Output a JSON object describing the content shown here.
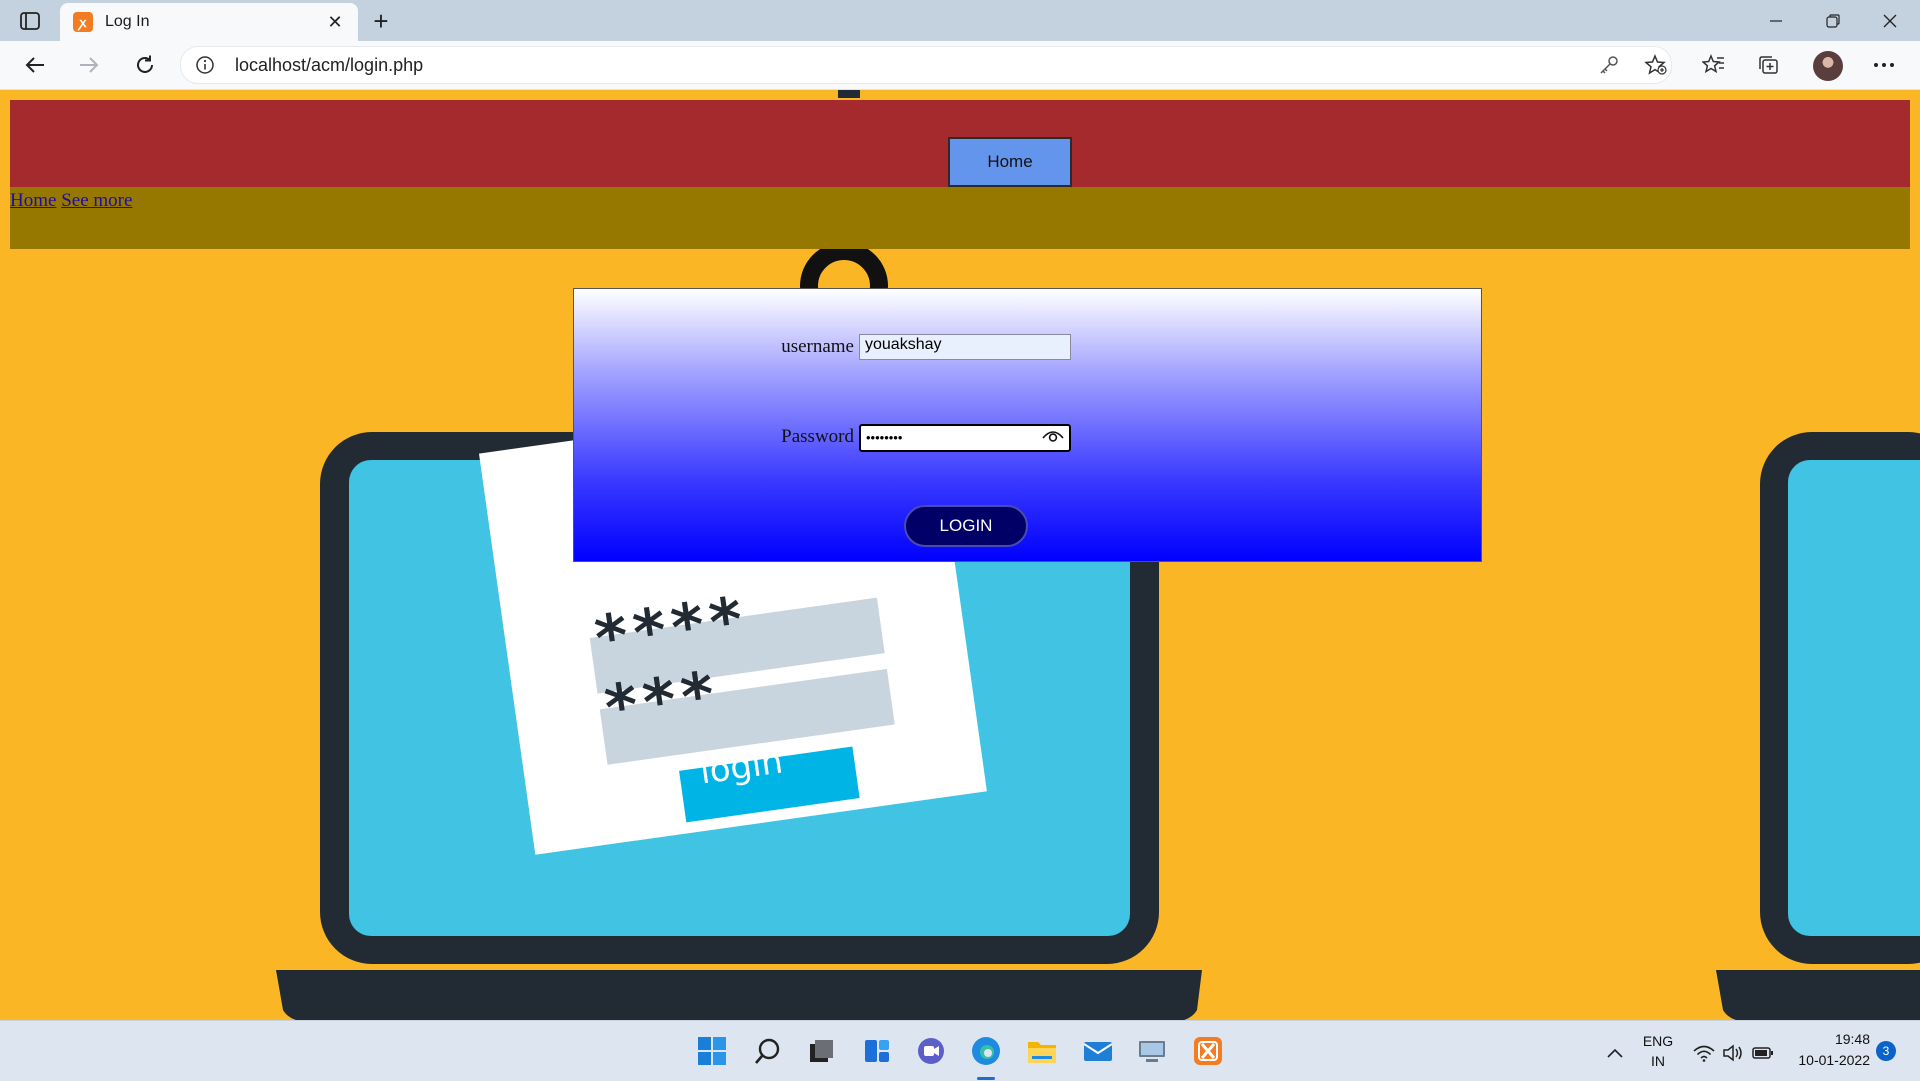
{
  "browser": {
    "tab_title": "Log In",
    "favicon_glyph": "ꭗ",
    "address": "localhost/acm/login.php"
  },
  "page": {
    "nav_button": "Home",
    "links": [
      "Home",
      "See more"
    ],
    "form": {
      "username_label": "username",
      "username_value": "youakshay",
      "password_label": "Password",
      "password_value": "••••••••",
      "login_label": "LOGIN"
    },
    "illustration": {
      "password_rows": [
        "****",
        "***"
      ],
      "button_text": "login"
    }
  },
  "taskbar": {
    "language": "ENG",
    "region": "IN",
    "time": "19:48",
    "date": "10-01-2022",
    "notification_count": "3"
  },
  "colors": {
    "page_background": "#FBB625",
    "header_red": "#A52A2D",
    "header_olive": "#967800",
    "home_button": "#6495ED",
    "login_button": "#000066",
    "laptop_screen": "#41C3E3",
    "laptop_frame": "#222B33"
  }
}
